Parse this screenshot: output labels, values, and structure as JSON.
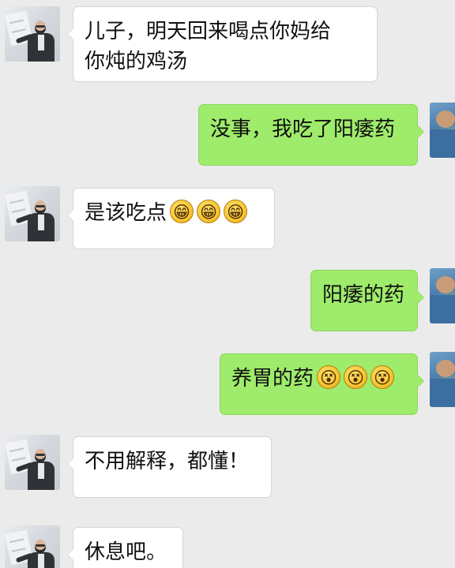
{
  "messages": [
    {
      "side": "left",
      "lines": [
        "儿子，明天回来喝点你妈给",
        "你炖的鸡汤"
      ]
    },
    {
      "side": "right",
      "lines": [
        "没事，我吃了阳痿药"
      ]
    },
    {
      "side": "left",
      "text": "是该吃点",
      "emoji_icon": "grin-emoji-icon",
      "emoji_glyph": "😁"
    },
    {
      "side": "right",
      "lines": [
        "阳痿的药"
      ]
    },
    {
      "side": "right",
      "text": "养胃的药",
      "emoji_icon": "dizzy-face-emoji-icon",
      "emoji_glyph": "😵"
    },
    {
      "side": "left",
      "lines": [
        "不用解释，都懂！"
      ]
    },
    {
      "side": "left",
      "lines": [
        "休息吧。"
      ]
    }
  ],
  "colors": {
    "background": "#ebebeb",
    "incoming_bubble": "#ffffff",
    "outgoing_bubble": "#9feb6b"
  }
}
